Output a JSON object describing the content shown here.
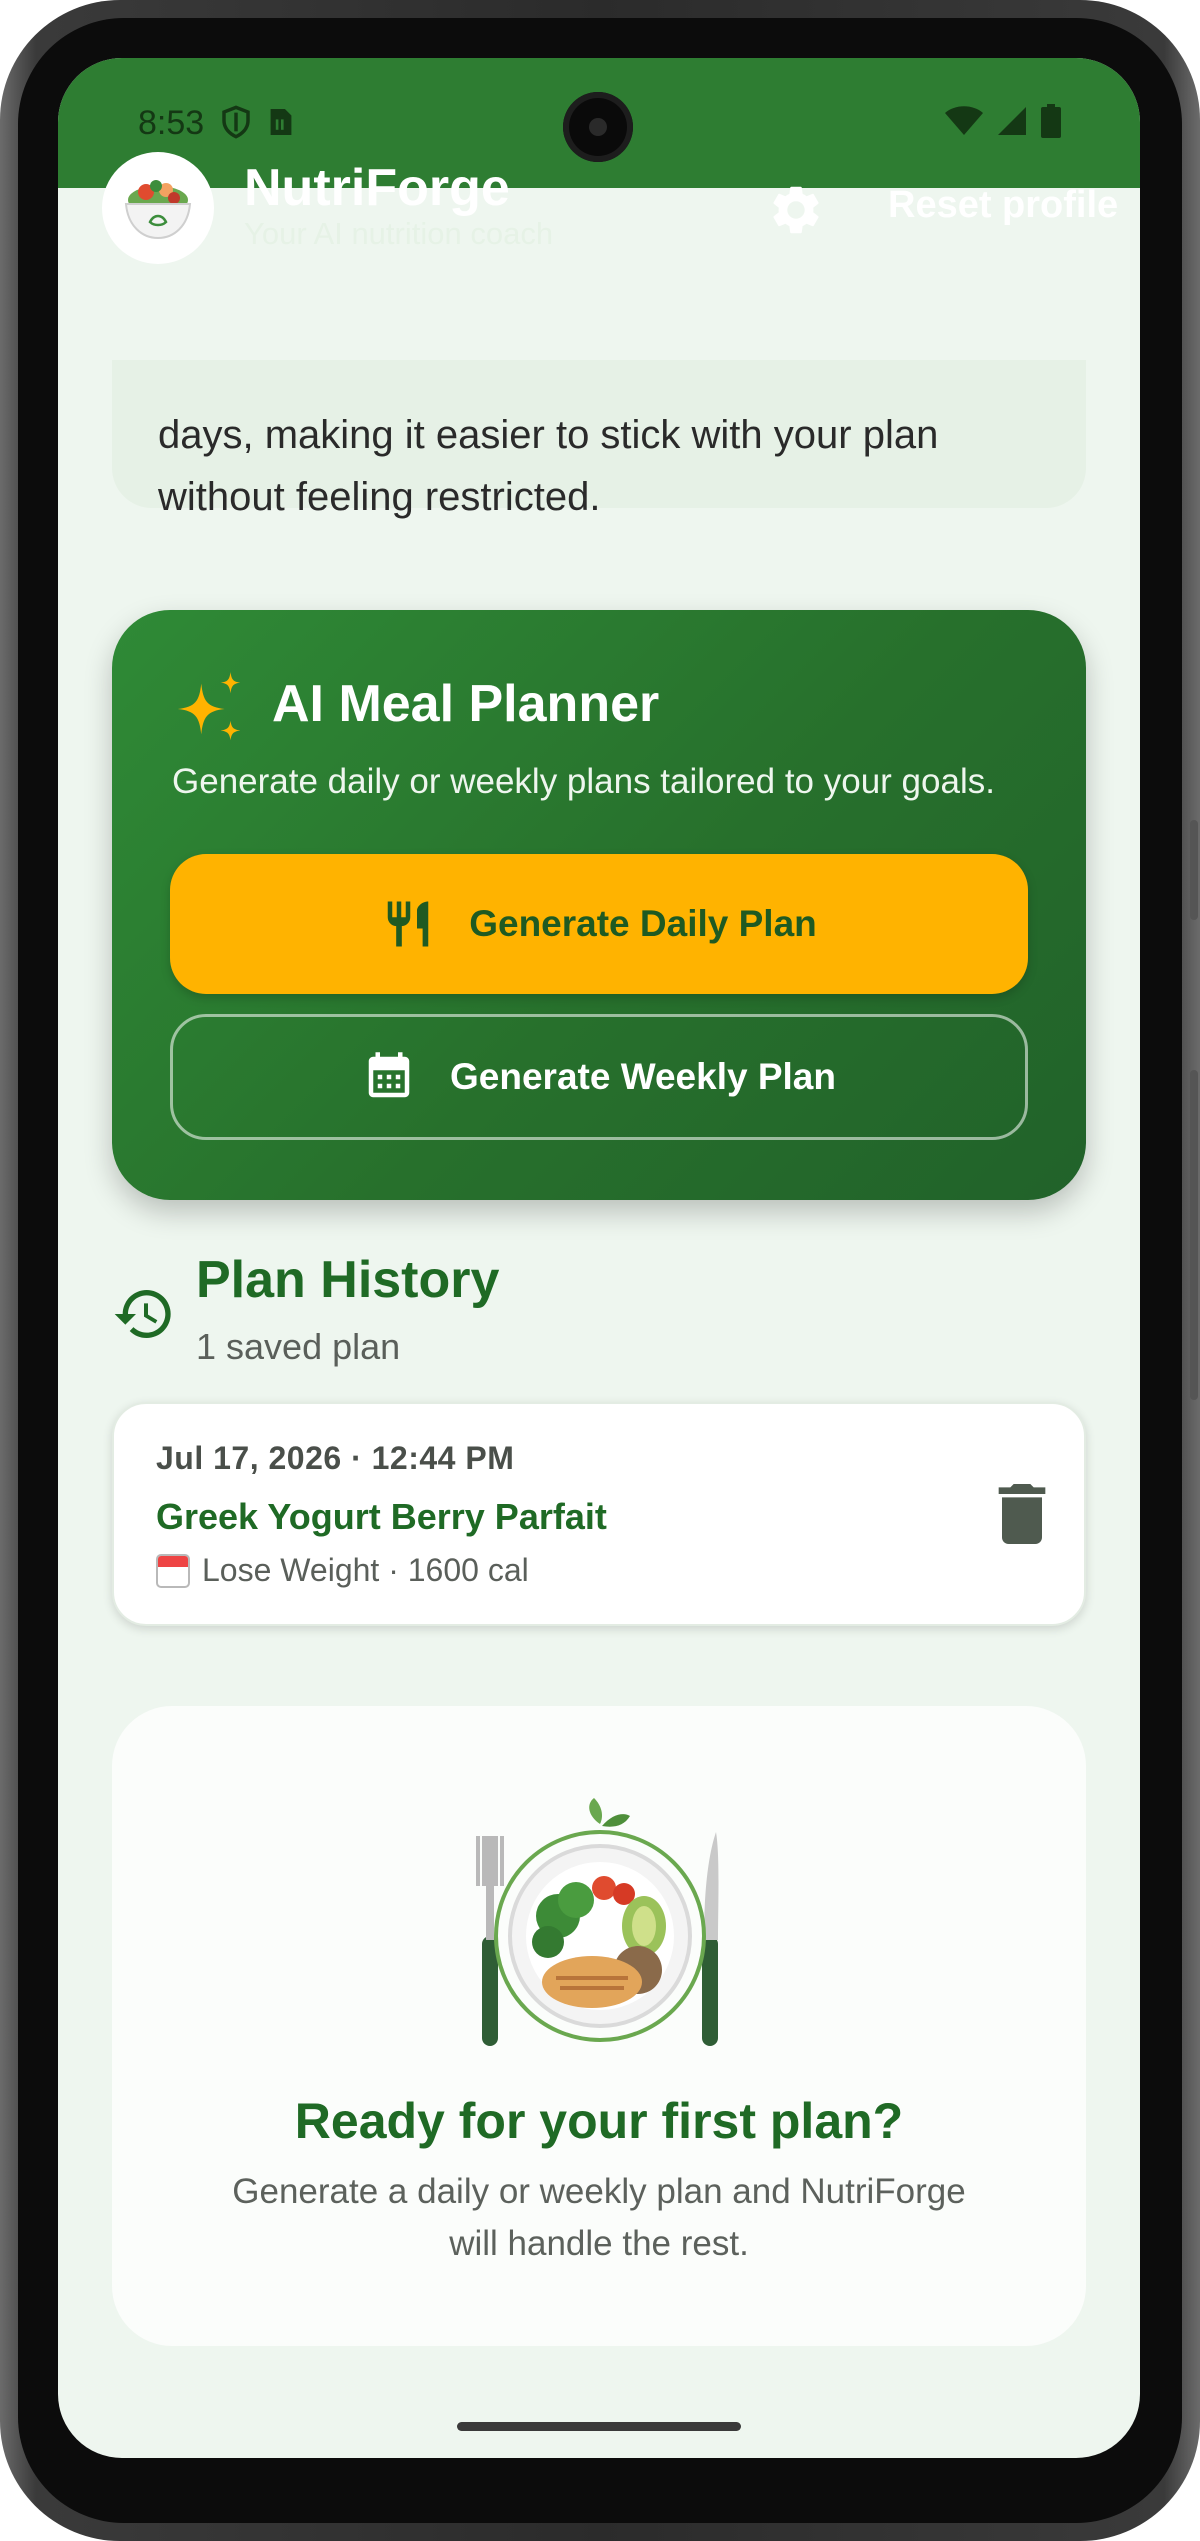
{
  "status_bar": {
    "time": "8:53",
    "icons_left": [
      "shield-icon",
      "sim-card-icon"
    ],
    "icons_right": [
      "wifi-icon",
      "signal-icon",
      "battery-icon"
    ]
  },
  "app_bar": {
    "title": "NutriForge",
    "subtitle": "Your AI nutrition coach",
    "reset_label": "Reset profile",
    "brand_color": "#2e7d32"
  },
  "info_card": {
    "text": "days, making it easier to stick with your plan without feeling restricted."
  },
  "planner": {
    "title": "AI Meal Planner",
    "description": "Generate daily or weekly plans tailored to your goals.",
    "daily_label": "Generate Daily Plan",
    "weekly_label": "Generate Weekly Plan",
    "accent_color": "#ffb300"
  },
  "history": {
    "title": "Plan History",
    "count": "1 saved plan",
    "plans": [
      {
        "date": "Jul 17, 2026 · 12:44 PM",
        "name": "Greek Yogurt Berry Parfait",
        "meta": "Lose Weight · 1600 cal"
      }
    ]
  },
  "empty_state": {
    "title": "Ready for your first plan?",
    "description": "Generate a daily or weekly plan and NutriForge will handle the rest."
  }
}
